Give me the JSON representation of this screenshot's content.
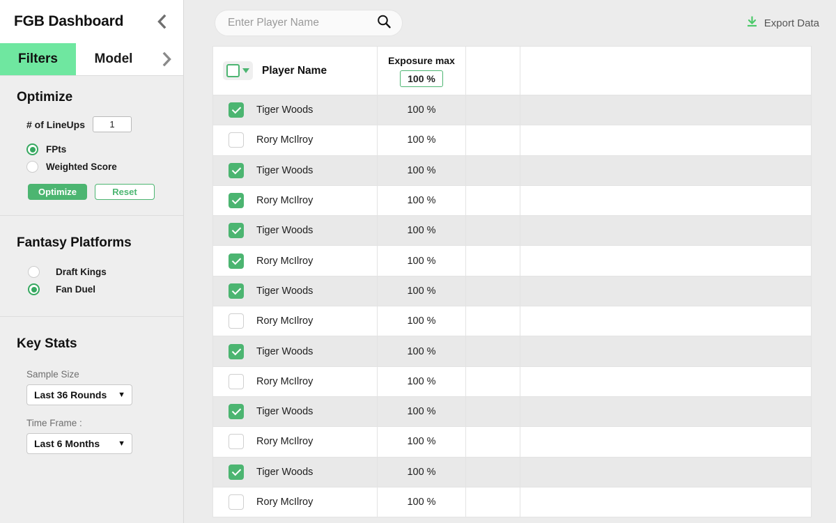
{
  "sidebar": {
    "brand_title": "FGB Dashboard",
    "collapse_icon": "chevron-left-icon",
    "tabs": [
      {
        "label": "Filters",
        "active": true
      },
      {
        "label": "Model",
        "active": false
      }
    ],
    "tab_next_icon": "chevron-right-icon",
    "optimize": {
      "title": "Optimize",
      "lineups_label": "# of LineUps",
      "lineups_value": "1",
      "radios": [
        {
          "label": "FPts",
          "selected": true
        },
        {
          "label": "Weighted Score",
          "selected": false
        }
      ],
      "optimize_button": "Optimize",
      "reset_button": "Reset"
    },
    "platforms": {
      "title": "Fantasy Platforms",
      "radios": [
        {
          "label": "Draft Kings",
          "selected": false
        },
        {
          "label": "Fan Duel",
          "selected": true
        }
      ]
    },
    "key_stats": {
      "title": "Key Stats",
      "sample_size_label": "Sample Size",
      "sample_size_value": "Last 36 Rounds",
      "time_frame_label": "Time Frame :",
      "time_frame_value": "Last 6 Months",
      "caret_icon": "caret-down-icon"
    }
  },
  "topbar": {
    "search_placeholder": "Enter Player Name",
    "search_value": "",
    "search_icon": "search-icon",
    "export_label": "Export Data",
    "export_icon": "download-icon"
  },
  "table": {
    "headers": {
      "select_all_icon": "checkbox-dropdown-icon",
      "player_name": "Player Name",
      "exposure_max": "Exposure max",
      "exposure_max_value": "100 %",
      "col3": "",
      "col4": ""
    },
    "rows": [
      {
        "checked": true,
        "name": "Tiger Woods",
        "exposure": "100 %"
      },
      {
        "checked": false,
        "name": "Rory McIlroy",
        "exposure": "100 %"
      },
      {
        "checked": true,
        "name": "Tiger Woods",
        "exposure": "100 %"
      },
      {
        "checked": true,
        "name": "Rory McIlroy",
        "exposure": "100 %"
      },
      {
        "checked": true,
        "name": "Tiger Woods",
        "exposure": "100 %"
      },
      {
        "checked": true,
        "name": "Rory McIlroy",
        "exposure": "100 %"
      },
      {
        "checked": true,
        "name": "Tiger Woods",
        "exposure": "100 %"
      },
      {
        "checked": false,
        "name": "Rory McIlroy",
        "exposure": "100 %"
      },
      {
        "checked": true,
        "name": "Tiger Woods",
        "exposure": "100 %"
      },
      {
        "checked": false,
        "name": "Rory McIlroy",
        "exposure": "100 %"
      },
      {
        "checked": true,
        "name": "Tiger Woods",
        "exposure": "100 %"
      },
      {
        "checked": false,
        "name": "Rory McIlroy",
        "exposure": "100 %"
      },
      {
        "checked": true,
        "name": "Tiger Woods",
        "exposure": "100 %"
      },
      {
        "checked": false,
        "name": "Rory McIlroy",
        "exposure": "100 %"
      }
    ]
  },
  "colors": {
    "tab_active": "#6FE7A0",
    "accent_green": "#4CB571",
    "export_green": "#4CC96A",
    "row_alt": "#e9e9e9",
    "page_bg": "#ececec"
  }
}
